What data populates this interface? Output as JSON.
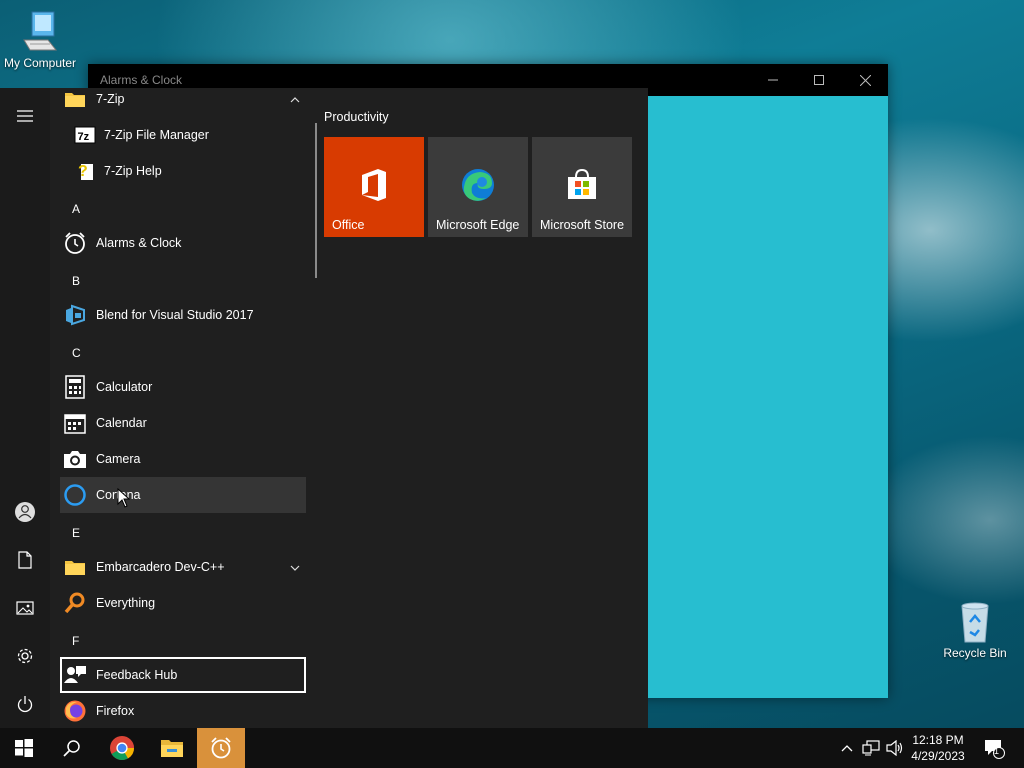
{
  "desktop": {
    "icons": [
      {
        "label": "My Computer",
        "icon": "computer-icon"
      },
      {
        "label": "Recycle Bin",
        "icon": "recycle-bin-icon"
      }
    ]
  },
  "window": {
    "title": "Alarms & Clock",
    "controls": [
      "minimize",
      "maximize",
      "close"
    ],
    "background": "#27bed0"
  },
  "start_menu": {
    "app_list": [
      {
        "type": "folder",
        "label": "7-Zip",
        "expanded": true,
        "icon": "folder-icon"
      },
      {
        "type": "subapp",
        "label": "7-Zip File Manager",
        "icon": "7zip-icon"
      },
      {
        "type": "subapp",
        "label": "7-Zip Help",
        "icon": "help-icon"
      },
      {
        "type": "letter",
        "label": "A"
      },
      {
        "type": "app",
        "label": "Alarms & Clock",
        "icon": "alarm-clock-icon"
      },
      {
        "type": "letter",
        "label": "B"
      },
      {
        "type": "app",
        "label": "Blend for Visual Studio 2017",
        "icon": "blend-icon"
      },
      {
        "type": "letter",
        "label": "C"
      },
      {
        "type": "app",
        "label": "Calculator",
        "icon": "calculator-icon"
      },
      {
        "type": "app",
        "label": "Calendar",
        "icon": "calendar-icon"
      },
      {
        "type": "app",
        "label": "Camera",
        "icon": "camera-icon"
      },
      {
        "type": "app",
        "label": "Cortana",
        "icon": "cortana-icon",
        "state": "hover"
      },
      {
        "type": "letter",
        "label": "E"
      },
      {
        "type": "folder",
        "label": "Embarcadero Dev-C++",
        "expanded": false,
        "icon": "folder-icon"
      },
      {
        "type": "app",
        "label": "Everything",
        "icon": "magnifier-icon"
      },
      {
        "type": "letter",
        "label": "F"
      },
      {
        "type": "app",
        "label": "Feedback Hub",
        "icon": "feedback-hub-icon",
        "state": "focused"
      },
      {
        "type": "app",
        "label": "Firefox",
        "icon": "firefox-icon"
      }
    ],
    "tiles_group": "Productivity",
    "tiles": [
      {
        "label": "Office",
        "icon": "office-icon",
        "color": "#d83b01"
      },
      {
        "label": "Microsoft Edge",
        "icon": "edge-icon",
        "color": "#3b3b3b"
      },
      {
        "label": "Microsoft Store",
        "icon": "store-icon",
        "color": "#3b3b3b"
      }
    ],
    "rail": [
      "menu-icon",
      "user-icon",
      "documents-icon",
      "pictures-icon",
      "settings-icon",
      "power-icon"
    ]
  },
  "taskbar": {
    "pinned": [
      "start-icon",
      "search-icon",
      "chrome-icon",
      "file-explorer-icon",
      "alarms-clock-icon"
    ],
    "active": "alarms-clock-icon",
    "accent": "#d9913b",
    "tray_icons": [
      "chevron-up-icon",
      "network-icon",
      "volume-icon"
    ],
    "time": "12:18 PM",
    "date": "4/29/2023",
    "notification_count": "1"
  }
}
